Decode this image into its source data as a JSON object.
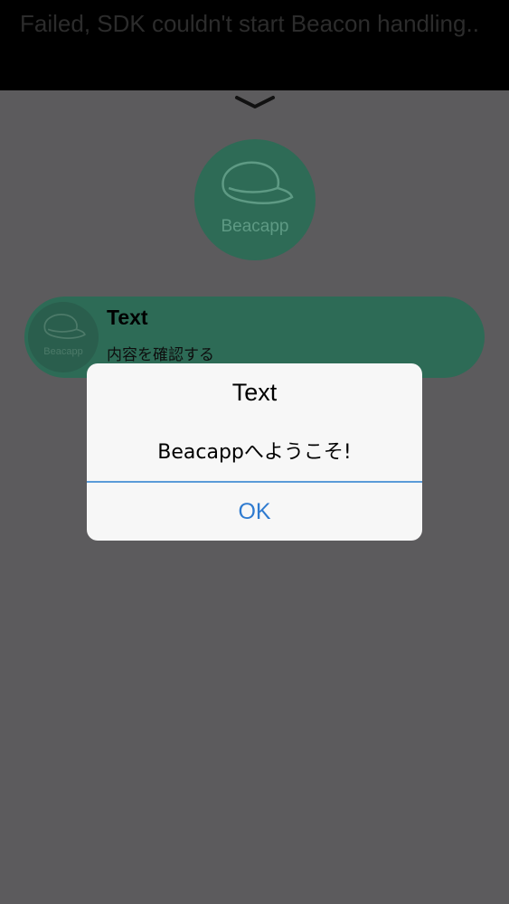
{
  "banner": {
    "message": "Failed, SDK couldn't start Beacon handling.."
  },
  "brand": {
    "logo_text": "Beacapp",
    "accent_color": "#2e6b56"
  },
  "notification": {
    "icon_text": "Beacapp",
    "title": "Text",
    "body": "内容を確認する"
  },
  "alert": {
    "title": "Text",
    "message": "Beacappへようこそ!",
    "ok_label": "OK"
  },
  "icons": {
    "chevron": "chevron-down-icon",
    "logo": "cap-icon"
  }
}
